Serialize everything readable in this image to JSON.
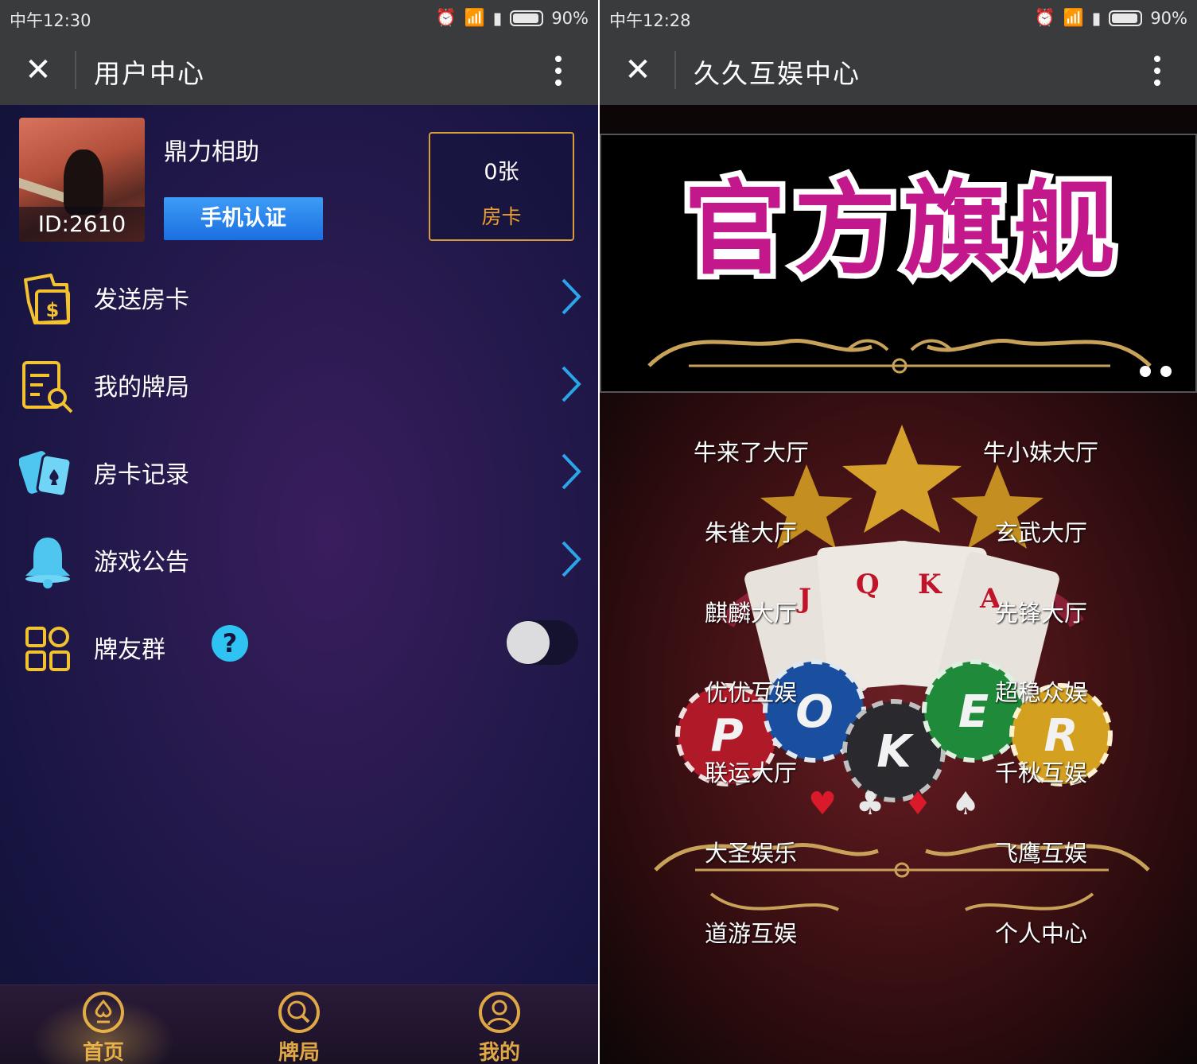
{
  "left": {
    "status": {
      "time": "中午12:30",
      "battery": "90%"
    },
    "title": "用户中心",
    "profile": {
      "id": "ID:2610",
      "name": "鼎力相助",
      "verify_label": "手机认证"
    },
    "room_cards": {
      "count": "0张",
      "label": "房卡"
    },
    "menu": [
      {
        "label": "发送房卡",
        "icon": "money-box-icon"
      },
      {
        "label": "我的牌局",
        "icon": "search-list-icon"
      },
      {
        "label": "房卡记录",
        "icon": "card-record-icon"
      },
      {
        "label": "游戏公告",
        "icon": "bell-icon"
      },
      {
        "label": "牌友群",
        "icon": "grid-icon",
        "help": "?",
        "toggle": "off"
      }
    ],
    "tabs": [
      {
        "label": "首页",
        "icon": "home-spade-icon",
        "active": true
      },
      {
        "label": "牌局",
        "icon": "search-icon"
      },
      {
        "label": "我的",
        "icon": "user-icon"
      }
    ]
  },
  "right": {
    "status": {
      "time": "中午12:28",
      "battery": "90%"
    },
    "title": "久久互娱中心",
    "banner": {
      "text": "官方旗舰"
    },
    "halls_left": [
      "牛来了大厅",
      "朱雀大厅",
      "麒麟大厅",
      "优优互娱",
      "联运大厅",
      "大圣娱乐",
      "道游互娱"
    ],
    "halls_right": [
      "牛小妹大厅",
      "玄武大厅",
      "先锋大厅",
      "超稳众娱",
      "千秋互娱",
      "飞鹰互娱",
      "个人中心"
    ],
    "poker_letters": [
      "P",
      "O",
      "K",
      "E",
      "R"
    ],
    "card_letters": [
      "J",
      "Q",
      "K",
      "A"
    ]
  },
  "colors": {
    "accent_blue": "#3e9cf6",
    "gold": "#e0a845",
    "banner_magenta": "#c2188c",
    "help_cyan": "#2ec3f2"
  }
}
